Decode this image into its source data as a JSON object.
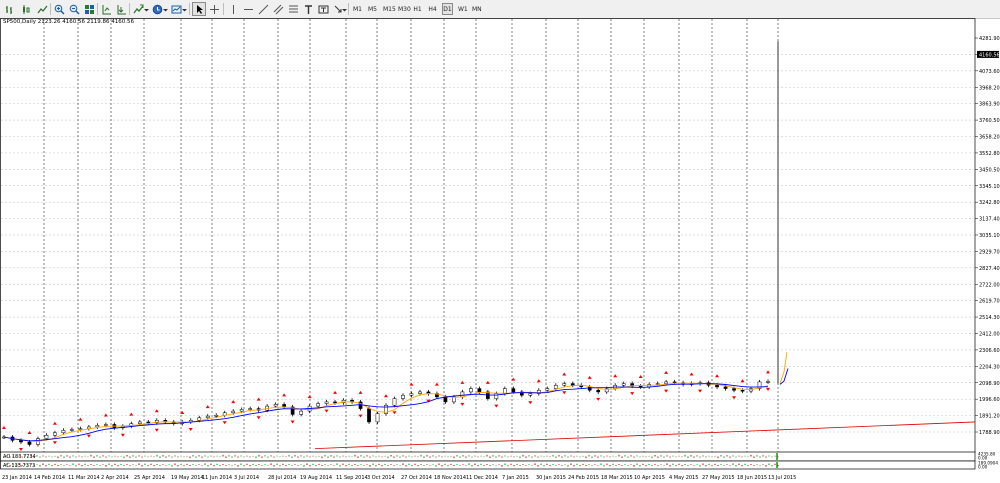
{
  "toolbar": {
    "timeframes": [
      "M1",
      "M5",
      "M15",
      "M30",
      "H1",
      "H4",
      "D1",
      "W1",
      "MN"
    ],
    "active_timeframe": "D1"
  },
  "chart": {
    "title": "SP500,Daily  2123.26 4160.56 2119.86 4160.56",
    "current_price_label": "4160.56",
    "colors": {
      "candle": "#000000",
      "ma_fast": "#ffa500",
      "ma_slow": "#0000ff",
      "trend_line": "#dc0000",
      "fractal": "#ff0000",
      "price_marker_bg": "#000000"
    }
  },
  "sub_windows": [
    {
      "label": "AO 183.7734",
      "right_labels": [
        "4235.80",
        "0.00"
      ]
    },
    {
      "label": "AC 133.7373",
      "right_labels": [
        "189.0904",
        "0.00"
      ]
    }
  ],
  "chart_data": {
    "type": "candlestick",
    "title": "SP500,Daily  2123.26 4160.56 2119.86 4160.56",
    "y_ticks": [
      "4281.90",
      "4160.56",
      "4073.60",
      "3968.20",
      "3863.90",
      "3760.50",
      "3658.20",
      "3552.80",
      "3450.50",
      "3345.10",
      "3242.80",
      "3137.40",
      "3035.10",
      "2929.70",
      "2827.40",
      "2722.00",
      "2619.70",
      "2514.30",
      "2412.00",
      "2306.60",
      "2204.30",
      "2098.90",
      "1996.60",
      "1891.20",
      "1788.90"
    ],
    "x_ticks": [
      "23 Jan 2014",
      "14 Feb 2014",
      "11 Mar 2014",
      "2 Apr 2014",
      "25 Apr 2014",
      "19 May 2014",
      "11 Jun 2014",
      "3 Jul 2014",
      "28 Jul 2014",
      "19 Aug 2014",
      "11 Sep 2014",
      "3 Oct 2014",
      "27 Oct 2014",
      "18 Nov 2014",
      "11 Dec 2014",
      "7 Jan 2015",
      "30 Jan 2015",
      "24 Feb 2015",
      "18 Mar 2015",
      "10 Apr 2015",
      "4 May 2015",
      "27 May 2015",
      "18 Jun 2015",
      "13 Jul 2015"
    ],
    "ylim": [
      1700,
      4300
    ],
    "last_spike_high": 4160.56,
    "series": [
      {
        "name": "close",
        "values": [
          1790,
          1770,
          1760,
          1745,
          1780,
          1800,
          1815,
          1830,
          1835,
          1840,
          1850,
          1860,
          1865,
          1845,
          1855,
          1870,
          1880,
          1875,
          1890,
          1880,
          1870,
          1880,
          1890,
          1905,
          1915,
          1920,
          1935,
          1945,
          1955,
          1960,
          1950,
          1975,
          1985,
          1970,
          1925,
          1945,
          1975,
          1990,
          2000,
          1995,
          2010,
          2000,
          1960,
          1880,
          1930,
          1980,
          2020,
          2040,
          2050,
          2060,
          2050,
          2030,
          2000,
          2030,
          2060,
          2080,
          2060,
          2020,
          2050,
          2080,
          2060,
          2040,
          2050,
          2070,
          2080,
          2100,
          2110,
          2100,
          2090,
          2070,
          2060,
          2080,
          2100,
          2110,
          2095,
          2090,
          2105,
          2110,
          2120,
          2115,
          2105,
          2110,
          2115,
          2100,
          2090,
          2080,
          2070,
          2065,
          2080,
          2120,
          2123
        ]
      }
    ]
  }
}
